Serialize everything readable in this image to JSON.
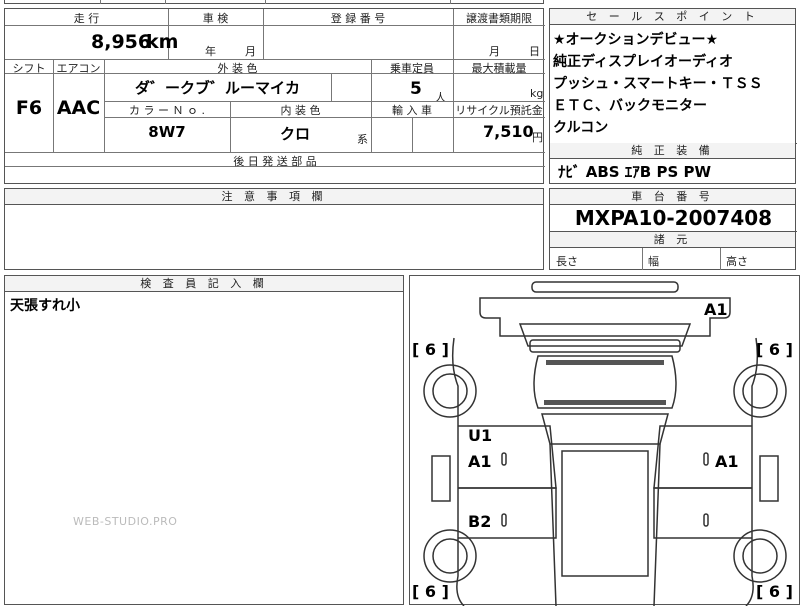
{
  "top_strip": {
    "partial_text": "ー ー ー ー"
  },
  "mileage": {
    "label": "走 行",
    "value": "8,956",
    "unit": "km"
  },
  "inspection": {
    "label": "車 検",
    "year": "年",
    "month": "月"
  },
  "registration": {
    "label": "登 録 番 号",
    "value": ""
  },
  "transfer": {
    "label": "譲渡書類期限",
    "month": "月",
    "day": "日"
  },
  "shift": {
    "label": "シフト",
    "value": "F6"
  },
  "aircon": {
    "label": "エアコン",
    "value": "AAC"
  },
  "exterior_color": {
    "label": "外 装 色",
    "value": "ダ゛ークブ゛ルーマイカ"
  },
  "capacity": {
    "label": "乗車定員",
    "value": "5",
    "unit": "人"
  },
  "max_load": {
    "label": "最大積載量",
    "unit": "kg"
  },
  "color_no": {
    "label": "カ ラ ー Ｎ ｏ .",
    "value": "8W7"
  },
  "interior_color": {
    "label": "内 装 色",
    "value": "クロ",
    "suffix": "系"
  },
  "import": {
    "label": "輸 入 車"
  },
  "recycle": {
    "label": "リサイクル預託金",
    "value": "7,510",
    "unit": "円"
  },
  "later_parts": {
    "label": "後 日 発 送 部 品"
  },
  "sales_points": {
    "label": "セ ー ル ス ポ イ ン ト",
    "lines": [
      "★オークションデビュー★",
      "純正ディスプレイオーディオ",
      "プッシュ・スマートキー・ＴＳＳ",
      "ＥＴＣ、バックモニター",
      "クルコン"
    ]
  },
  "genuine_equipment": {
    "label": "純 正 装 備",
    "value": "ﾅﾋﾞ ABS ｴｱB PS PW"
  },
  "notes": {
    "label": "注 意 事 項 欄"
  },
  "chassis": {
    "label": "車 台 番 号",
    "value": "MXPA10-2007408"
  },
  "dimensions": {
    "label": "諸 元",
    "length": "長さ",
    "width": "幅",
    "height": "高さ"
  },
  "inspector": {
    "label": "検 査 員 記 入 欄",
    "note": "天張すれ小"
  },
  "watermark": "WEB-STUDIO.PRO",
  "diagram_marks": {
    "a1_top": "A1",
    "left_top": "[ 6 ]",
    "right_top": "[ 6 ]",
    "u1": "U1",
    "a1_left": "A1",
    "a1_right": "A1",
    "b2": "B2",
    "left_bottom": "[ 6 ]",
    "right_bottom": "[ 6 ]"
  }
}
